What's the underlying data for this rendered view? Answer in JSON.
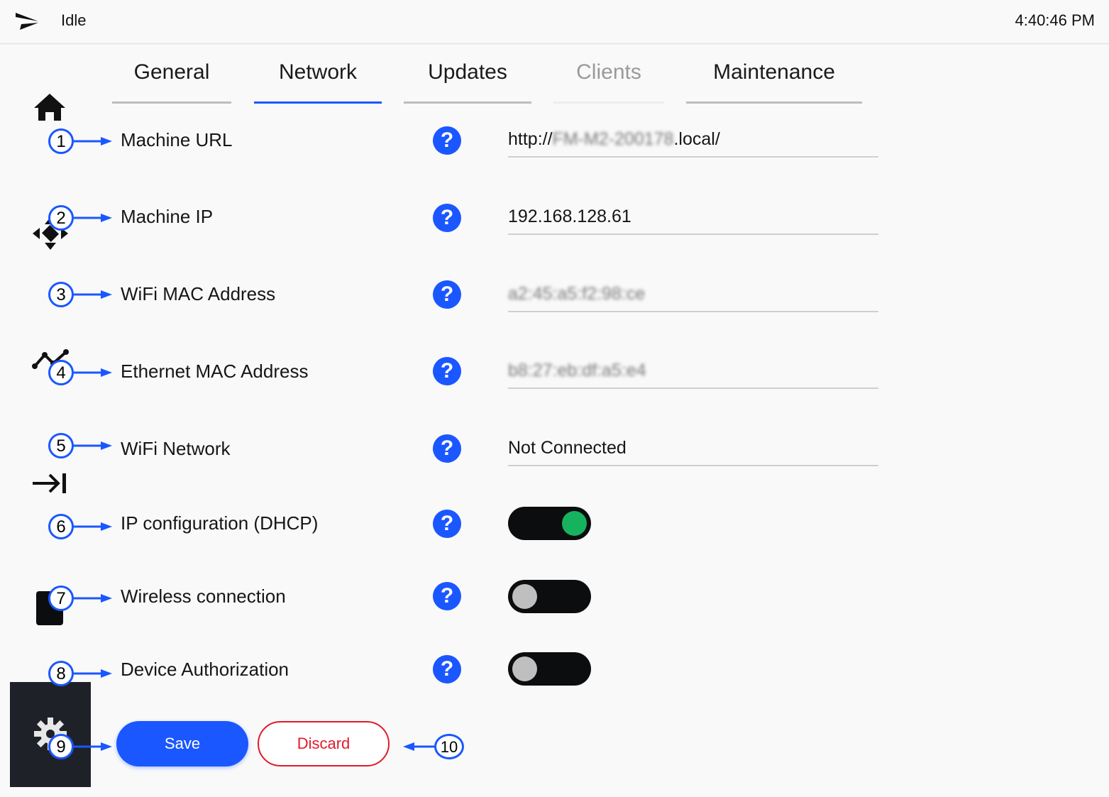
{
  "header": {
    "status": "Idle",
    "clock": "4:40:46 PM",
    "logo_icon": "paper-plane-logo-icon"
  },
  "tabs": [
    {
      "label": "General",
      "state": "normal"
    },
    {
      "label": "Network",
      "state": "active"
    },
    {
      "label": "Updates",
      "state": "normal"
    },
    {
      "label": "Clients",
      "state": "disabled"
    },
    {
      "label": "Maintenance",
      "state": "normal"
    }
  ],
  "sidebar": {
    "icons": [
      "home-icon",
      "move-arrows-icon",
      "line-chart-icon",
      "tab-arrow-icon",
      "document-icon",
      "gear-icon"
    ],
    "active": "gear-icon"
  },
  "settings": {
    "machine_url": {
      "label": "Machine URL",
      "prefix": "http://",
      "redacted": "FM-M2-200178",
      "suffix": ".local/"
    },
    "machine_ip": {
      "label": "Machine IP",
      "value": "192.168.128.61"
    },
    "wifi_mac": {
      "label": "WiFi MAC Address",
      "redacted": "a2:45:a5:f2:98:ce"
    },
    "ethernet_mac": {
      "label": "Ethernet MAC Address",
      "redacted": "b8:27:eb:df:a5:e4"
    },
    "wifi_network": {
      "label": "WiFi Network",
      "value": "Not Connected"
    },
    "dhcp": {
      "label": "IP configuration (DHCP)",
      "enabled": true
    },
    "wireless": {
      "label": "Wireless connection",
      "enabled": false
    },
    "device_auth": {
      "label": "Device Authorization",
      "enabled": false
    },
    "help_glyph": "?"
  },
  "actions": {
    "save": "Save",
    "discard": "Discard"
  },
  "callouts": [
    "1",
    "2",
    "3",
    "4",
    "5",
    "6",
    "7",
    "8",
    "9",
    "10"
  ],
  "colors": {
    "accent": "#1a57ff",
    "toggle_on": "#17b25e",
    "toggle_off": "#bfbfbf",
    "danger": "#e01b2b"
  }
}
